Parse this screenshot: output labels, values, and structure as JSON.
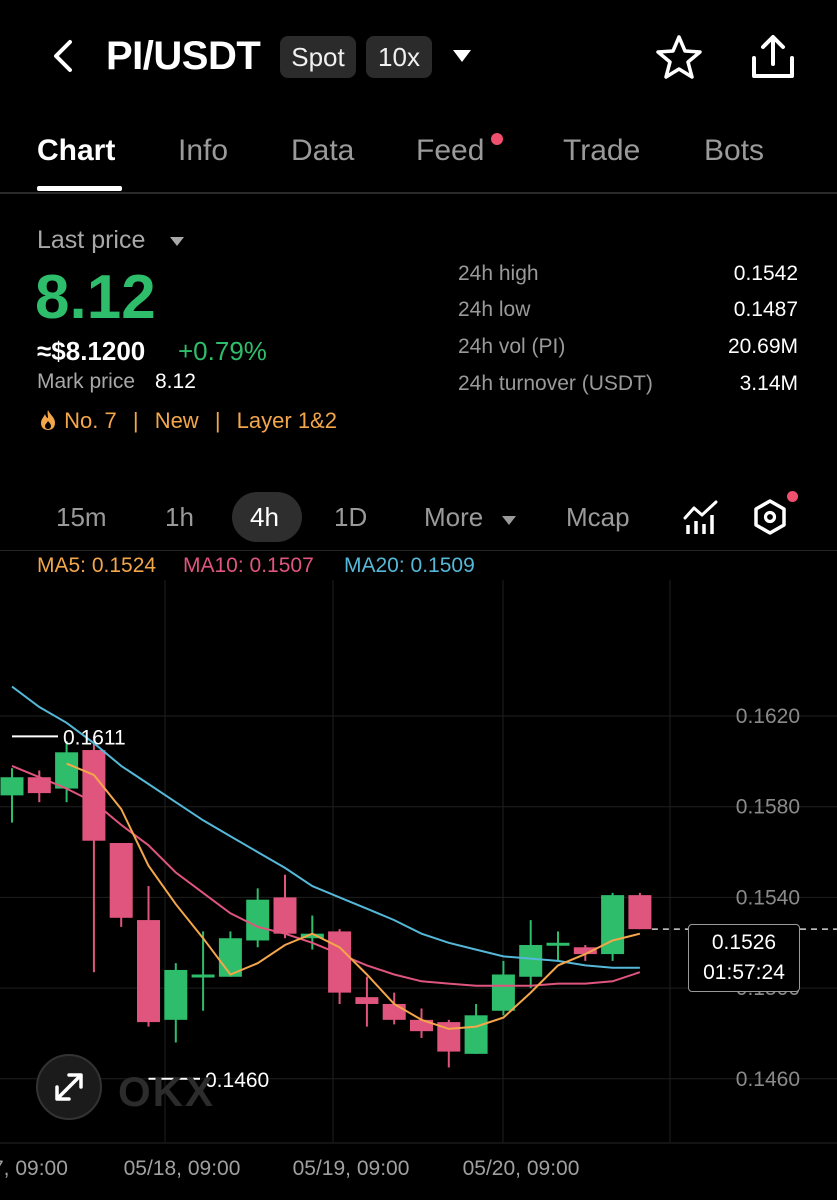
{
  "header": {
    "pair": "PI/USDT",
    "market_type": "Spot",
    "leverage": "10x"
  },
  "tabs": [
    {
      "label": "Chart",
      "active": true
    },
    {
      "label": "Info"
    },
    {
      "label": "Data"
    },
    {
      "label": "Feed",
      "has_notification": true
    },
    {
      "label": "Trade"
    },
    {
      "label": "Bots"
    }
  ],
  "price": {
    "label": "Last price",
    "value": "8.12",
    "usd": "≈$8.1200",
    "change": "+0.79%",
    "mark_label": "Mark price",
    "mark_value": "8.12",
    "tags": [
      "No. 7",
      "New",
      "Layer 1&2"
    ],
    "separator": "|"
  },
  "stats": [
    {
      "label": "24h high",
      "value": "0.1542"
    },
    {
      "label": "24h low",
      "value": "0.1487"
    },
    {
      "label": "24h vol (PI)",
      "value": "20.69M"
    },
    {
      "label": "24h turnover (USDT)",
      "value": "3.14M"
    }
  ],
  "timeframes": {
    "items": [
      "15m",
      "1h",
      "4h",
      "1D",
      "More",
      "Mcap"
    ],
    "active": "4h"
  },
  "ma_legend": [
    {
      "text": "MA5: 0.1524",
      "color": "#f3a64a"
    },
    {
      "text": "MA10: 0.1507",
      "color": "#e0557e"
    },
    {
      "text": "MA20: 0.1509",
      "color": "#55b8d8"
    }
  ],
  "chart": {
    "current_price": "0.1526",
    "countdown": "01:57:24",
    "high_marker": "0.1611",
    "low_marker": "0.1460",
    "watermark": "OKX"
  },
  "colors": {
    "up": "#2ebd6b",
    "down": "#e0557e",
    "ma5": "#f3a64a",
    "ma10": "#e0557e",
    "ma20": "#55b8d8",
    "accent_tag": "#f3a64a"
  },
  "chart_data": {
    "type": "candlestick",
    "interval": "4h",
    "y_ticks": [
      0.162,
      0.158,
      0.154,
      0.15,
      0.146
    ],
    "y_tick_labels": [
      "0.1620",
      "0.1580",
      "0.1540",
      "0.1500",
      "0.1460"
    ],
    "x_tick_labels": [
      "7, 09:00",
      "05/18, 09:00",
      "05/19, 09:00",
      "05/20, 09:00"
    ],
    "ylim": [
      0.1433,
      0.168
    ],
    "candles": [
      {
        "o": 0.1585,
        "h": 0.1597,
        "l": 0.1573,
        "c": 0.1593
      },
      {
        "o": 0.1593,
        "h": 0.1596,
        "l": 0.1582,
        "c": 0.1586
      },
      {
        "o": 0.1588,
        "h": 0.1609,
        "l": 0.1582,
        "c": 0.1604
      },
      {
        "o": 0.1605,
        "h": 0.1611,
        "l": 0.1507,
        "c": 0.1565
      },
      {
        "o": 0.1564,
        "h": 0.1564,
        "l": 0.1527,
        "c": 0.1531
      },
      {
        "o": 0.153,
        "h": 0.1545,
        "l": 0.1483,
        "c": 0.1485
      },
      {
        "o": 0.1486,
        "h": 0.1511,
        "l": 0.1476,
        "c": 0.1508
      },
      {
        "o": 0.1506,
        "h": 0.1525,
        "l": 0.149,
        "c": 0.1506
      },
      {
        "o": 0.1505,
        "h": 0.1525,
        "l": 0.1505,
        "c": 0.1522
      },
      {
        "o": 0.1521,
        "h": 0.1544,
        "l": 0.1518,
        "c": 0.1539
      },
      {
        "o": 0.154,
        "h": 0.155,
        "l": 0.1522,
        "c": 0.1524
      },
      {
        "o": 0.1522,
        "h": 0.1532,
        "l": 0.1517,
        "c": 0.1524
      },
      {
        "o": 0.1525,
        "h": 0.1526,
        "l": 0.1493,
        "c": 0.1498
      },
      {
        "o": 0.1496,
        "h": 0.1505,
        "l": 0.1483,
        "c": 0.1493
      },
      {
        "o": 0.1493,
        "h": 0.1498,
        "l": 0.1484,
        "c": 0.1486
      },
      {
        "o": 0.1486,
        "h": 0.1491,
        "l": 0.1478,
        "c": 0.1481
      },
      {
        "o": 0.1485,
        "h": 0.1486,
        "l": 0.1465,
        "c": 0.1472
      },
      {
        "o": 0.1471,
        "h": 0.1493,
        "l": 0.1471,
        "c": 0.1488
      },
      {
        "o": 0.149,
        "h": 0.1512,
        "l": 0.1488,
        "c": 0.1506
      },
      {
        "o": 0.1505,
        "h": 0.153,
        "l": 0.15,
        "c": 0.1519
      },
      {
        "o": 0.1519,
        "h": 0.1525,
        "l": 0.1512,
        "c": 0.152
      },
      {
        "o": 0.1518,
        "h": 0.1519,
        "l": 0.1512,
        "c": 0.1515
      },
      {
        "o": 0.1515,
        "h": 0.1542,
        "l": 0.1512,
        "c": 0.1541
      },
      {
        "o": 0.1541,
        "h": 0.1542,
        "l": 0.1526,
        "c": 0.1526
      }
    ],
    "ma5": [
      null,
      null,
      0.1599,
      0.1594,
      0.1579,
      0.1554,
      0.1537,
      0.1522,
      0.1506,
      0.1511,
      0.1519,
      0.1524,
      0.1518,
      0.1506,
      0.1493,
      0.1486,
      0.1482,
      0.1483,
      0.1487,
      0.1498,
      0.151,
      0.1515,
      0.1521,
      0.1524
    ],
    "ma10": [
      0.1598,
      0.1593,
      0.1588,
      0.1582,
      0.1572,
      0.1563,
      0.1551,
      0.1542,
      0.1533,
      0.1527,
      0.1524,
      0.152,
      0.1515,
      0.151,
      0.1506,
      0.1503,
      0.1502,
      0.1501,
      0.1501,
      0.1501,
      0.1502,
      0.1502,
      0.1503,
      0.1507
    ],
    "ma20": [
      0.1633,
      0.1624,
      0.1617,
      0.1608,
      0.1598,
      0.159,
      0.1582,
      0.1574,
      0.1567,
      0.156,
      0.1553,
      0.1545,
      0.154,
      0.1535,
      0.153,
      0.1524,
      0.152,
      0.1517,
      0.1514,
      0.1513,
      0.1512,
      0.151,
      0.1509,
      0.1509
    ]
  }
}
